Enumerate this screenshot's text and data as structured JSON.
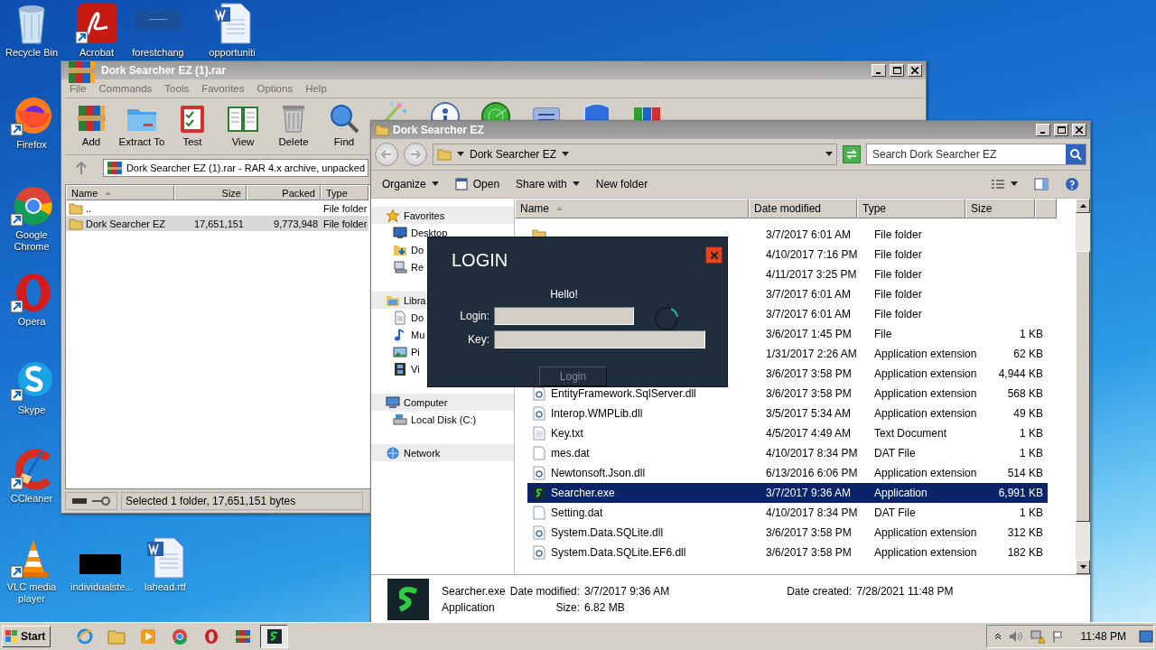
{
  "desktop_icons": [
    {
      "label": "Recycle Bin",
      "kind": "recycle",
      "shortcut": false
    },
    {
      "label": "Acrobat",
      "kind": "acrobat",
      "shortcut": true
    },
    {
      "label": "forestchang",
      "kind": "thumb",
      "shortcut": false
    },
    {
      "label": "opportuniti",
      "kind": "word",
      "shortcut": false
    },
    {
      "label": "Firefox",
      "kind": "firefox",
      "shortcut": true
    },
    {
      "label": "Google Chrome",
      "kind": "chrome",
      "shortcut": true
    },
    {
      "label": "Opera",
      "kind": "opera",
      "shortcut": true
    },
    {
      "label": "Skype",
      "kind": "skype",
      "shortcut": true
    },
    {
      "label": "CCleaner",
      "kind": "ccleaner",
      "shortcut": true
    },
    {
      "label": "VLC media player",
      "kind": "vlc",
      "shortcut": true
    },
    {
      "label": "individualste...",
      "kind": "black",
      "shortcut": false
    },
    {
      "label": "lahead.rtf",
      "kind": "word",
      "shortcut": false
    }
  ],
  "winrar": {
    "title": "Dork Searcher EZ (1).rar",
    "menu": [
      "File",
      "Commands",
      "Tools",
      "Favorites",
      "Options",
      "Help"
    ],
    "toolbar": [
      {
        "label": "Add",
        "kind": "add"
      },
      {
        "label": "Extract To",
        "kind": "extract"
      },
      {
        "label": "Test",
        "kind": "test"
      },
      {
        "label": "View",
        "kind": "view"
      },
      {
        "label": "Delete",
        "kind": "delete"
      },
      {
        "label": "Find",
        "kind": "find"
      },
      {
        "kind": "wizard"
      },
      {
        "kind": "info"
      },
      {
        "kind": "scan"
      },
      {
        "kind": "comment"
      },
      {
        "kind": "protect"
      },
      {
        "kind": "sfx"
      }
    ],
    "address": "Dork Searcher EZ (1).rar - RAR 4.x archive, unpacked",
    "columns": [
      "Name",
      "Size",
      "Packed",
      "Type"
    ],
    "rows": [
      {
        "name": "..",
        "type": "File folder",
        "selected": false
      },
      {
        "name": "Dork Searcher EZ",
        "size": "17,651,151",
        "packed": "9,773,948",
        "type": "File folder",
        "selected": true
      }
    ],
    "status": "Selected 1 folder, 17,651,151 bytes"
  },
  "explorer": {
    "title": "Dork Searcher EZ",
    "breadcrumb": "Dork Searcher EZ",
    "search": {
      "placeholder": "Search Dork Searcher EZ"
    },
    "toolbar": [
      {
        "label": "Organize",
        "kind": "menu"
      },
      {
        "label": "Open",
        "kind": "open"
      },
      {
        "label": "Share with",
        "kind": "menu"
      },
      {
        "label": "New folder",
        "kind": "plain"
      }
    ],
    "nav": [
      {
        "label": "Favorites",
        "kind": "star",
        "children": [
          {
            "label": "Desktop",
            "kind": "desktop"
          },
          {
            "label": "Do",
            "kind": "downloads"
          },
          {
            "label": "Re",
            "kind": "recent"
          }
        ]
      },
      {
        "label": "Libra",
        "kind": "library",
        "children": [
          {
            "label": "Do",
            "kind": "document"
          },
          {
            "label": "Mu",
            "kind": "music"
          },
          {
            "label": "Pi",
            "kind": "pictures"
          },
          {
            "label": "Vi",
            "kind": "videos"
          }
        ]
      },
      {
        "label": "Computer",
        "kind": "computer",
        "children": [
          {
            "label": "Local Disk (C:)",
            "kind": "disk"
          }
        ]
      },
      {
        "label": "Network",
        "kind": "network"
      }
    ],
    "columns": [
      "Name",
      "Date modified",
      "Type",
      "Size"
    ],
    "rows": [
      {
        "kind": "folder",
        "date": "3/7/2017 6:01 AM",
        "type": "File folder",
        "selected": false
      },
      {
        "date": "4/10/2017 7:16 PM",
        "type": "File folder",
        "selected": false
      },
      {
        "date": "4/11/2017 3:25 PM",
        "type": "File folder",
        "selected": false
      },
      {
        "date": "3/7/2017 6:01 AM",
        "type": "File folder",
        "selected": false
      },
      {
        "date": "3/7/2017 6:01 AM",
        "type": "File folder",
        "selected": false
      },
      {
        "date": "3/6/2017 1:45 PM",
        "type": "File",
        "size": "1 KB",
        "selected": false
      },
      {
        "date": "1/31/2017 2:26 AM",
        "type": "Application extension",
        "size": "62 KB",
        "selected": false
      },
      {
        "date": "3/6/2017 3:58 PM",
        "type": "Application extension",
        "size": "4,944 KB",
        "selected": false
      },
      {
        "kind": "dll",
        "name": "EntityFramework.SqlServer.dll",
        "date": "3/6/2017 3:58 PM",
        "type": "Application extension",
        "size": "568 KB",
        "selected": false
      },
      {
        "kind": "dll",
        "name": "Interop.WMPLib.dll",
        "date": "3/5/2017 5:34 AM",
        "type": "Application extension",
        "size": "49 KB",
        "selected": false
      },
      {
        "kind": "text",
        "name": "Key.txt",
        "date": "4/5/2017 4:49 AM",
        "type": "Text Document",
        "size": "1 KB",
        "selected": false
      },
      {
        "kind": "file",
        "name": "mes.dat",
        "date": "4/10/2017 8:34 PM",
        "type": "DAT File",
        "size": "1 KB",
        "selected": false
      },
      {
        "kind": "dll",
        "name": "Newtonsoft.Json.dll",
        "date": "6/13/2016 6:06 PM",
        "type": "Application extension",
        "size": "514 KB",
        "selected": false
      },
      {
        "kind": "exe",
        "name": "Searcher.exe",
        "date": "3/7/2017 9:36 AM",
        "type": "Application",
        "size": "6,991 KB",
        "selected": true
      },
      {
        "kind": "file",
        "name": "Setting.dat",
        "date": "4/10/2017 8:34 PM",
        "type": "DAT File",
        "size": "1 KB",
        "selected": false
      },
      {
        "kind": "dll",
        "name": "System.Data.SQLite.dll",
        "date": "3/6/2017 3:58 PM",
        "type": "Application extension",
        "size": "312 KB",
        "selected": false
      },
      {
        "kind": "dll",
        "name": "System.Data.SQLite.EF6.dll",
        "date": "3/6/2017 3:58 PM",
        "type": "Application extension",
        "size": "182 KB",
        "selected": false
      }
    ],
    "details": {
      "name": "Searcher.exe",
      "type": "Application",
      "modified_label": "Date modified:",
      "modified": "3/7/2017 9:36 AM",
      "size_label": "Size:",
      "size": "6.82 MB",
      "created_label": "Date created:",
      "created": "7/28/2021 11:48 PM"
    }
  },
  "login": {
    "title": "LOGIN",
    "greeting": "Hello!",
    "fields": [
      {
        "label": "Login:"
      },
      {
        "label": "Key:"
      }
    ],
    "button": {
      "label": "Login",
      "disabled": true
    }
  },
  "taskbar": {
    "start": "Start",
    "apps": [
      {
        "kind": "ie",
        "selected": false
      },
      {
        "kind": "explorer",
        "selected": false
      },
      {
        "kind": "media",
        "selected": false
      },
      {
        "kind": "chrome",
        "selected": false
      },
      {
        "kind": "opera",
        "selected": false
      },
      {
        "kind": "winrar",
        "selected": false
      },
      {
        "kind": "searcher",
        "selected": true
      }
    ],
    "clock": "11:48 PM"
  }
}
